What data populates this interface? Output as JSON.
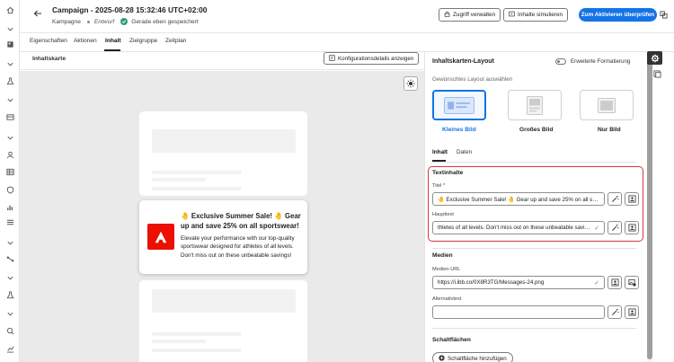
{
  "header": {
    "title": "Campaign - 2025-08-28 15:32:46 UTC+02:00",
    "type": "Kampagne",
    "status": "Entwurf",
    "saved": "Gerade eben gespeichert",
    "manage_access": "Zugriff verwalten",
    "simulate": "Inhalte simulieren",
    "primary": "Zum Aktivieren überprüfen"
  },
  "tabs": [
    "Eigenschaften",
    "Aktionen",
    "Inhalt",
    "Zielgruppe",
    "Zeitplan"
  ],
  "active_tab": "Inhalt",
  "canvas": {
    "label": "Inhaltskarte",
    "config_button": "Konfigurationsdetails anzeigen",
    "card": {
      "title": "🤚 Exclusive Summer Sale! 🤚 Gear up and save 25% on all sportswear!",
      "body": "Elevate your performance with our top-quality sportswear designed for athletes of all levels. Don't miss out on these unbeatable savings!"
    }
  },
  "panel": {
    "title": "Inhaltskarten-Layout",
    "toggle_label": "Erweiterte Formatierung",
    "layout_label": "Gewünschtes Layout auswählen",
    "layouts": [
      "Kleines Bild",
      "Großes Bild",
      "Nur Bild"
    ],
    "selected_layout": "Kleines Bild",
    "subtabs": [
      "Inhalt",
      "Daten"
    ],
    "text_section": "Textinhalte",
    "title_label": "Titel",
    "title_required": "*",
    "title_value": "🤚 Exclusive Summer Sale! 🤚 Gear up and save 25% on all sport...",
    "body_label": "Haupttext",
    "body_value": "thletes of all levels. Don't miss out on these unbeatable savings!",
    "media_section": "Medien",
    "media_url_label": "Medien-URL",
    "media_url_value": "https://i.ibb.co/0X8R3TG/Messages-24.png",
    "alt_label": "Alternativtext",
    "alt_value": "",
    "buttons_section": "Schaltflächen",
    "add_button": "Schaltfläche hinzufügen"
  },
  "colors": {
    "accent": "#1473e6",
    "highlight_border": "#d7373f",
    "success": "#2d9d78",
    "logo": "#eb1000"
  }
}
